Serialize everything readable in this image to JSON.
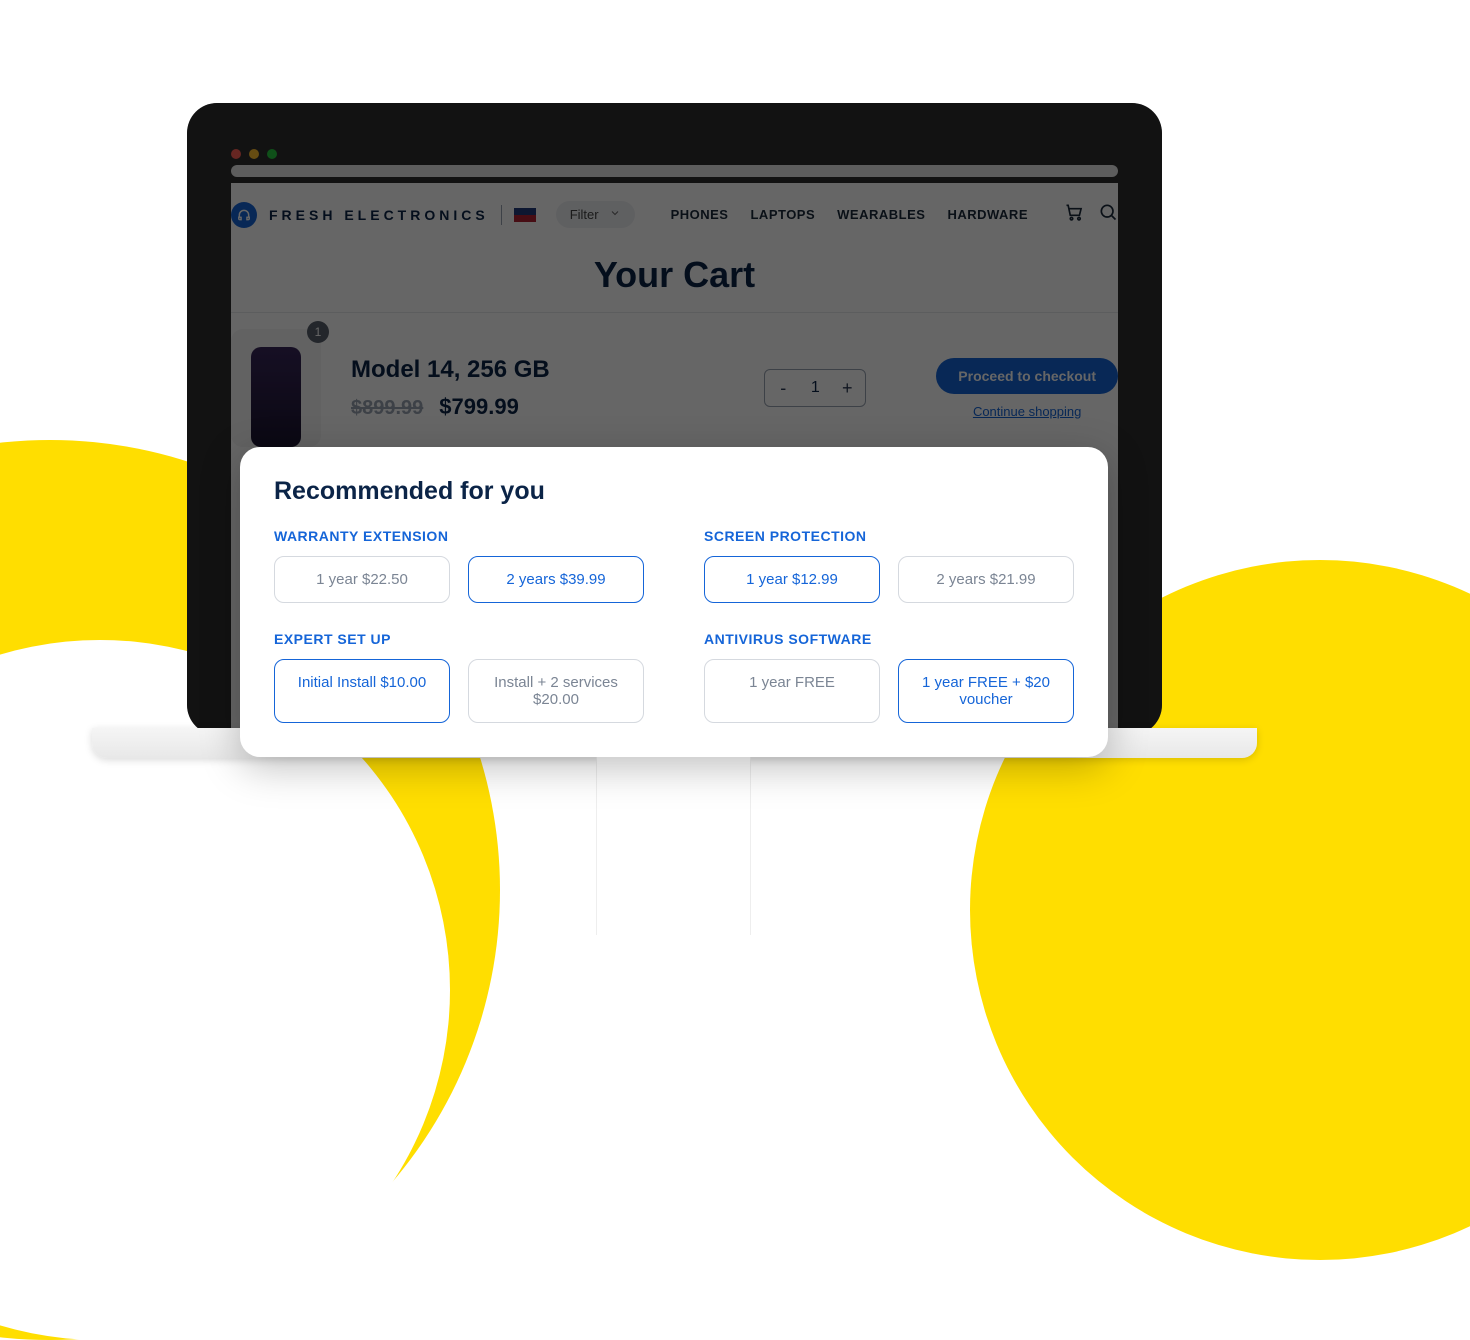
{
  "brand": {
    "name": "FRESH ELECTRONICS"
  },
  "header": {
    "filter_label": "Filter",
    "nav": [
      "PHONES",
      "LAPTOPS",
      "WEARABLES",
      "HARDWARE"
    ]
  },
  "cart": {
    "title": "Your Cart",
    "item": {
      "name": "Model 14, 256 GB",
      "price_old": "$899.99",
      "price_new": "$799.99",
      "quantity": "1",
      "badge": "1"
    },
    "checkout_label": "Proceed to checkout",
    "continue_label": "Continue shopping"
  },
  "modal": {
    "title": "Recommended for you",
    "groups": [
      {
        "label": "WARRANTY EXTENSION",
        "options": [
          {
            "text": "1 year $22.50",
            "selected": false
          },
          {
            "text": "2 years $39.99",
            "selected": true
          }
        ]
      },
      {
        "label": "SCREEN PROTECTION",
        "options": [
          {
            "text": "1 year $12.99",
            "selected": true
          },
          {
            "text": "2 years $21.99",
            "selected": false
          }
        ]
      },
      {
        "label": "EXPERT SET UP",
        "options": [
          {
            "text": "Initial Install $10.00",
            "selected": true
          },
          {
            "text": "Install + 2 services $20.00",
            "selected": false
          }
        ]
      },
      {
        "label": "ANTIVIRUS SOFTWARE",
        "options": [
          {
            "text": "1 year FREE",
            "selected": false
          },
          {
            "text": "1 year FREE + $20 voucher",
            "selected": true
          }
        ]
      }
    ]
  }
}
